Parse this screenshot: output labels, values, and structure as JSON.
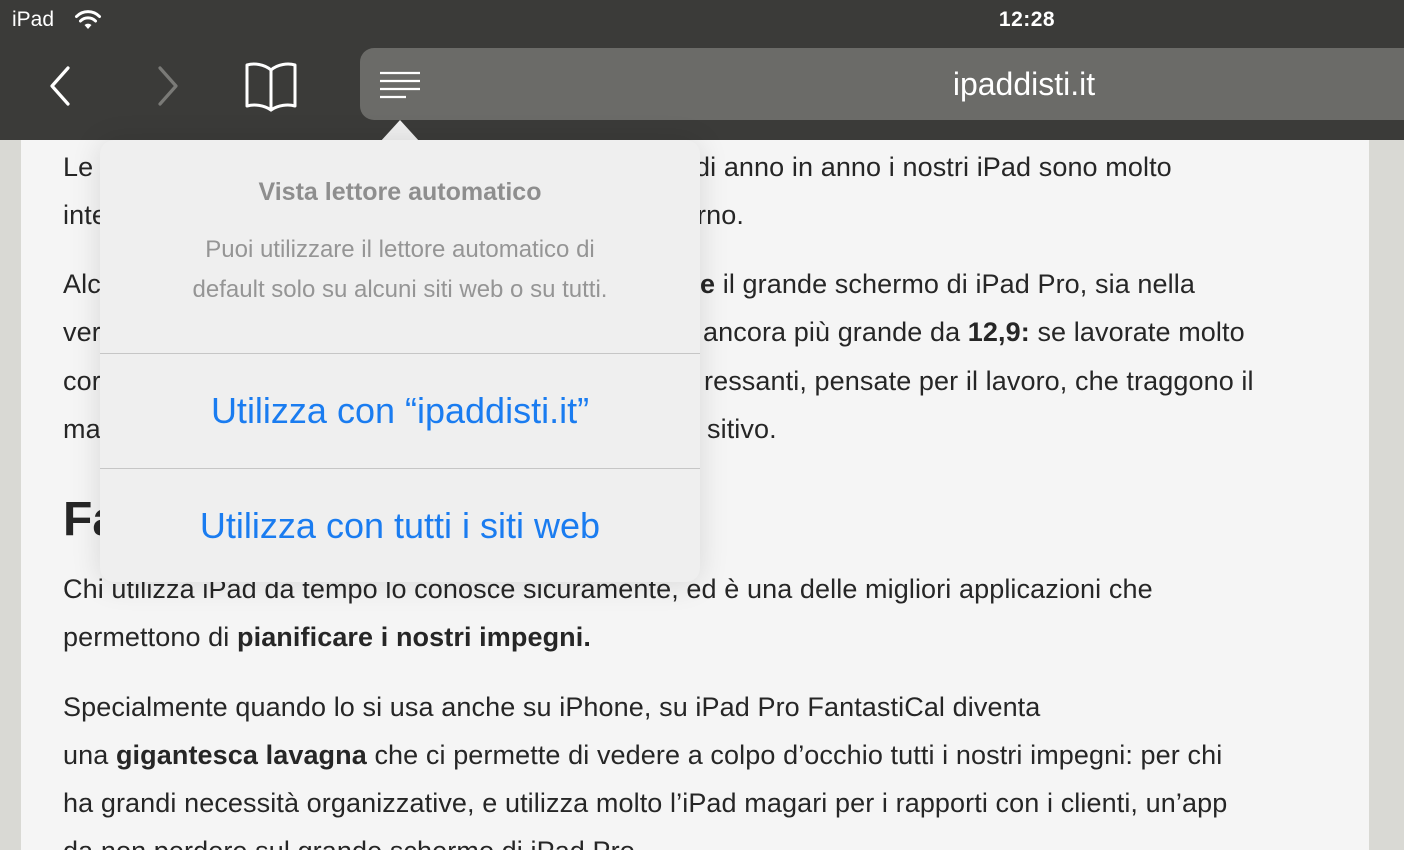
{
  "status_bar": {
    "device": "iPad",
    "time": "12:28"
  },
  "toolbar": {
    "url": "ipaddisti.it"
  },
  "article": {
    "p1_l1_a": "Le",
    "p1_l1_b": "di anno in anno i nostri iPad sono molto",
    "p1_l2_a": "inte",
    "p1_l2_b": "rno.",
    "p2_l1_a": "Alc",
    "p2_l1_bold": "e",
    "p2_l1_b": " il grande schermo di iPad Pro, sia nella",
    "p2_l2_a": "ver",
    "p2_l2_b": "ancora più grande da ",
    "p2_l2_bold": "12,9:",
    "p2_l2_c": " se lavorate molto",
    "p2_l3_a": "cor",
    "p2_l3_b": "ressanti, pensate per il lavoro, che traggono il",
    "p2_l4_a": "ma",
    "p2_l4_b": "sitivo.",
    "heading_partial": "Fa",
    "p3_l1": "Chi utilizza iPad da tempo lo conosce sicuramente, ed è una delle migliori applicazioni che",
    "p3_l2_a": "permettono di ",
    "p3_l2_bold": "pianificare i nostri impegni.",
    "p4_l1": "Specialmente quando lo si usa anche su iPhone, su iPad Pro FantastiCal diventa",
    "p4_l2_a": "una ",
    "p4_l2_bold": "gigantesca lavagna",
    "p4_l2_b": " che ci permette di vedere a colpo d’occhio tutti i nostri impegni: per chi",
    "p4_l3": "ha grandi necessità organizzative, e utilizza molto l’iPad magari per i rapporti con i clienti, un’app",
    "p4_l4": "da non perdere sul grande schermo di iPad Pro."
  },
  "popover": {
    "title": "Vista lettore automatico",
    "description_l1": "Puoi utilizzare il lettore automatico di",
    "description_l2": "default solo su alcuni siti web o su tutti.",
    "action_site": "Utilizza con “ipaddisti.it”",
    "action_all": "Utilizza con tutti i siti web"
  },
  "colors": {
    "toolbar": "#3b3b39",
    "address_bar": "#6b6b68",
    "accent_link": "#1a7cf0",
    "page_bg": "#f5f5f5"
  },
  "icons": [
    "wifi-icon",
    "chevron-left-icon",
    "chevron-right-icon",
    "book-icon",
    "reader-icon"
  ]
}
